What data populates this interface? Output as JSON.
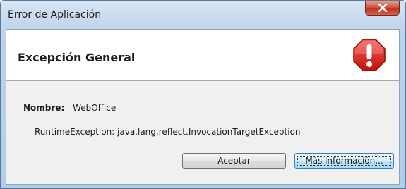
{
  "window": {
    "title": "Error de Aplicación"
  },
  "header": {
    "title": "Excepción General",
    "icon": "error-shield-icon",
    "icon_color": "#e0201b"
  },
  "details": {
    "name_label": "Nombre:",
    "name_value": "WebOffice",
    "message": "RuntimeException: java.lang.reflect.InvocationTargetException"
  },
  "buttons": {
    "accept_label": "Aceptar",
    "more_info_label": "Más información..."
  },
  "colors": {
    "close_button": "#c2341d",
    "title_bar": "#c5d8ed",
    "focused_button": "#bee6fd"
  }
}
